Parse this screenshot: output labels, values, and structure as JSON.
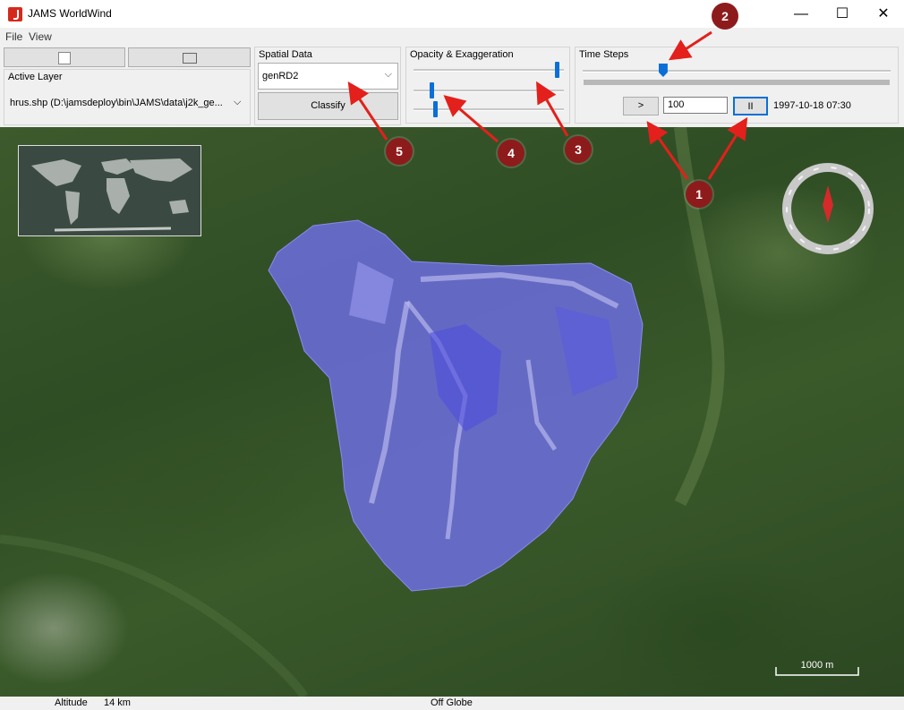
{
  "window": {
    "title": "JAMS WorldWind",
    "controls": {
      "minimize": "—",
      "maximize": "☐",
      "close": "✕"
    }
  },
  "menu": [
    {
      "label": "File"
    },
    {
      "label": "View"
    }
  ],
  "active_layer_panel": {
    "title": "Active Layer",
    "selected": "hrus.shp (D:\\jamsdeploy\\bin\\JAMS\\data\\j2k_ge..."
  },
  "spatial_data": {
    "title": "Spatial Data",
    "selected": "genRD2",
    "classify_label": "Classify"
  },
  "opacity_panel": {
    "title": "Opacity & Exaggeration",
    "sliders": [
      {
        "name": "slider-1",
        "value": 0.95
      },
      {
        "name": "slider-2",
        "value": 0.12
      },
      {
        "name": "slider-3",
        "value": 0.14
      }
    ]
  },
  "time_steps": {
    "title": "Time Steps",
    "slider_value": 0.26,
    "play_label": ">",
    "step_value": "100",
    "pause_label": "II",
    "current_time": "1997-10-18 07:30"
  },
  "map": {
    "scale_label": "1000 m"
  },
  "status": {
    "altitude_label": "Altitude",
    "altitude_value": "14 km",
    "globe_state": "Off Globe"
  },
  "callouts": [
    "1",
    "2",
    "3",
    "4",
    "5"
  ],
  "colors": {
    "accent": "#0a6fd6",
    "callout": "#8e1b1b",
    "arrow": "#e3201b",
    "overlay": "#6f6fe6"
  }
}
